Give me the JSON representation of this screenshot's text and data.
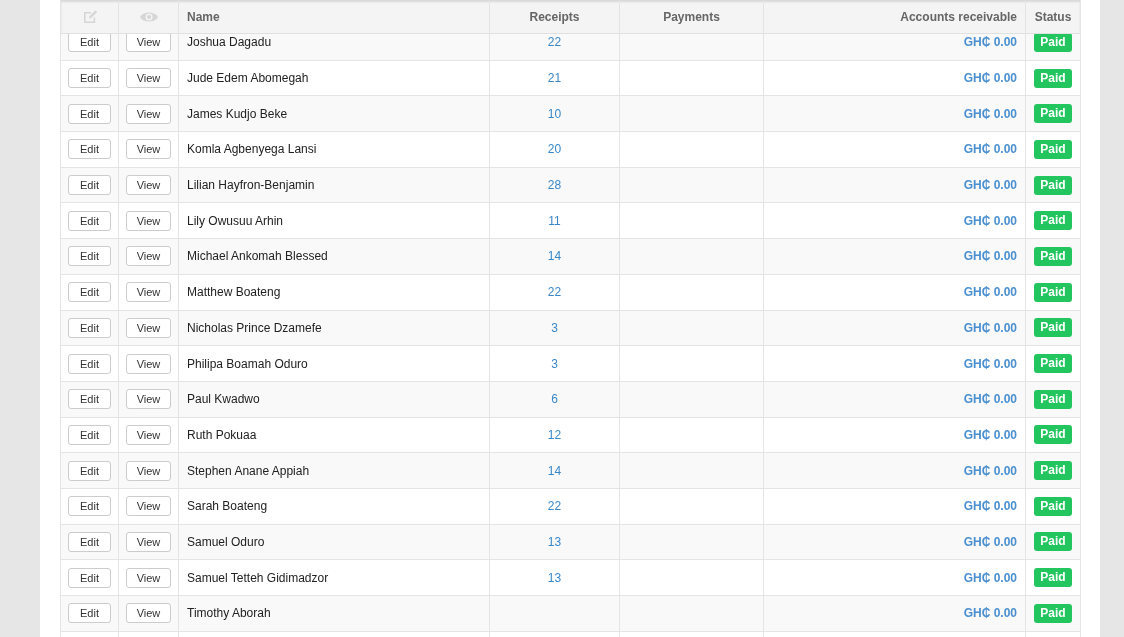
{
  "table": {
    "columns": [
      {
        "kind": "edit-icon"
      },
      {
        "kind": "view-icon"
      },
      {
        "kind": "text",
        "label": "Name"
      },
      {
        "kind": "text",
        "label": "Receipts"
      },
      {
        "kind": "text",
        "label": "Payments"
      },
      {
        "kind": "text",
        "label": "Accounts receivable"
      },
      {
        "kind": "text",
        "label": "Status"
      }
    ],
    "rows": [
      {
        "edit": "Edit",
        "view": "View",
        "name": "Joshua Dagadu",
        "receipts": "22",
        "accounts_receivable": "GH₵ 0.00",
        "status": "Paid"
      },
      {
        "edit": "Edit",
        "view": "View",
        "name": "Jude Edem Abomegah",
        "receipts": "21",
        "accounts_receivable": "GH₵ 0.00",
        "status": "Paid"
      },
      {
        "edit": "Edit",
        "view": "View",
        "name": "James Kudjo Beke",
        "receipts": "10",
        "accounts_receivable": "GH₵ 0.00",
        "status": "Paid"
      },
      {
        "edit": "Edit",
        "view": "View",
        "name": "Komla Agbenyega Lansi",
        "receipts": "20",
        "accounts_receivable": "GH₵ 0.00",
        "status": "Paid"
      },
      {
        "edit": "Edit",
        "view": "View",
        "name": "Lilian Hayfron-Benjamin",
        "receipts": "28",
        "accounts_receivable": "GH₵ 0.00",
        "status": "Paid"
      },
      {
        "edit": "Edit",
        "view": "View",
        "name": "Lily Owusuu Arhin",
        "receipts": "11",
        "accounts_receivable": "GH₵ 0.00",
        "status": "Paid"
      },
      {
        "edit": "Edit",
        "view": "View",
        "name": "Michael Ankomah Blessed",
        "receipts": "14",
        "accounts_receivable": "GH₵ 0.00",
        "status": "Paid"
      },
      {
        "edit": "Edit",
        "view": "View",
        "name": "Matthew Boateng",
        "receipts": "22",
        "accounts_receivable": "GH₵ 0.00",
        "status": "Paid"
      },
      {
        "edit": "Edit",
        "view": "View",
        "name": "Nicholas Prince Dzamefe",
        "receipts": "3",
        "accounts_receivable": "GH₵ 0.00",
        "status": "Paid"
      },
      {
        "edit": "Edit",
        "view": "View",
        "name": "Philipa Boamah Oduro",
        "receipts": "3",
        "accounts_receivable": "GH₵ 0.00",
        "status": "Paid"
      },
      {
        "edit": "Edit",
        "view": "View",
        "name": "Paul Kwadwo",
        "receipts": "6",
        "accounts_receivable": "GH₵ 0.00",
        "status": "Paid"
      },
      {
        "edit": "Edit",
        "view": "View",
        "name": "Ruth Pokuaa",
        "receipts": "12",
        "accounts_receivable": "GH₵ 0.00",
        "status": "Paid"
      },
      {
        "edit": "Edit",
        "view": "View",
        "name": "Stephen Anane Appiah",
        "receipts": "14",
        "accounts_receivable": "GH₵ 0.00",
        "status": "Paid"
      },
      {
        "edit": "Edit",
        "view": "View",
        "name": "Sarah Boateng",
        "receipts": "22",
        "accounts_receivable": "GH₵ 0.00",
        "status": "Paid"
      },
      {
        "edit": "Edit",
        "view": "View",
        "name": "Samuel Oduro",
        "receipts": "13",
        "accounts_receivable": "GH₵ 0.00",
        "status": "Paid"
      },
      {
        "edit": "Edit",
        "view": "View",
        "name": "Samuel Tetteh Gidimadzor",
        "receipts": "13",
        "accounts_receivable": "GH₵ 0.00",
        "status": "Paid"
      },
      {
        "edit": "Edit",
        "view": "View",
        "name": "Timothy Aborah",
        "accounts_receivable": "GH₵ 0.00",
        "status": "Paid"
      }
    ]
  }
}
